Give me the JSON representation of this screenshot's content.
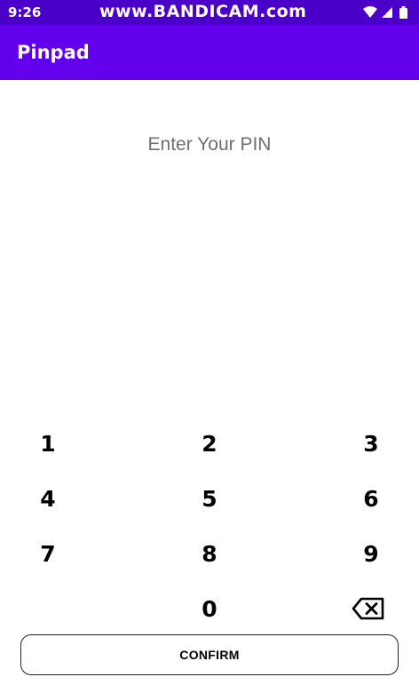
{
  "status_bar": {
    "time": "9:26",
    "watermark": "www.BANDICAM.com",
    "icons": [
      "wifi-icon",
      "signal-icon",
      "battery-icon"
    ]
  },
  "app_bar": {
    "title": "Pinpad",
    "color": "#6200ee"
  },
  "prompt": "Enter Your PIN",
  "keypad": {
    "keys": [
      "1",
      "2",
      "3",
      "4",
      "5",
      "6",
      "7",
      "8",
      "9",
      "0"
    ],
    "backspace_icon": "backspace-icon"
  },
  "confirm": {
    "label": "CONFIRM"
  }
}
